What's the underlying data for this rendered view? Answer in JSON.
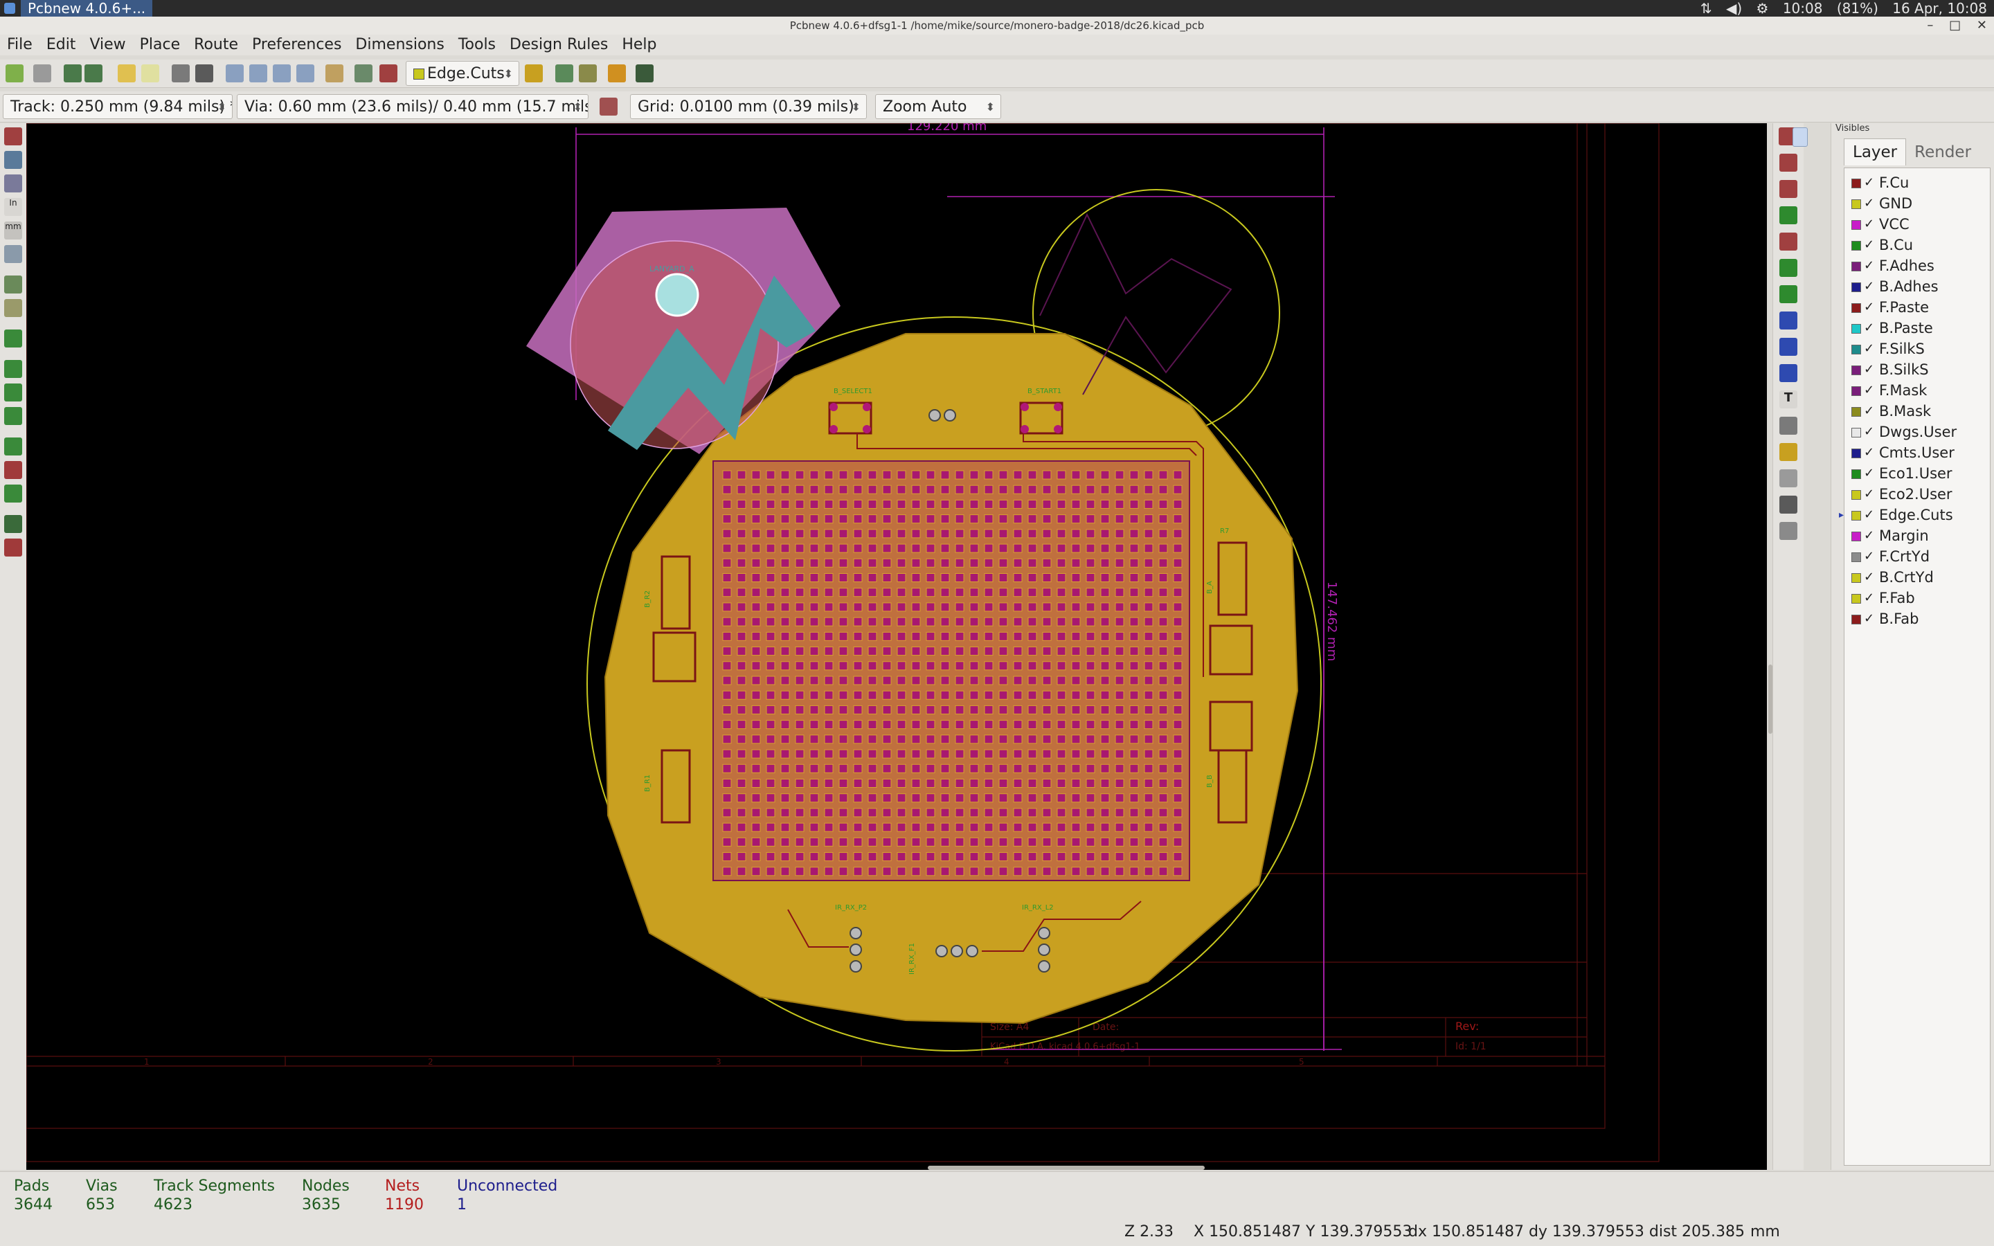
{
  "system_panel": {
    "task_title": "Pcbnew 4.0.6+...",
    "time": "10:08",
    "battery": "(81%)",
    "date_time": "16 Apr, 10:08"
  },
  "window": {
    "title": "Pcbnew 4.0.6+dfsg1-1 /home/mike/source/monero-badge-2018/dc26.kicad_pcb"
  },
  "menu": [
    "File",
    "Edit",
    "View",
    "Place",
    "Route",
    "Preferences",
    "Dimensions",
    "Tools",
    "Design Rules",
    "Help"
  ],
  "toolbar": {
    "layer_select": "Edge.Cuts",
    "track": "Track: 0.250 mm (9.84 mils) *",
    "via": "Via: 0.60 mm (23.6 mils)/ 0.40 mm (15.7 mils) *",
    "grid": "Grid: 0.0100 mm (0.39 mils)",
    "zoom": "Zoom Auto"
  },
  "board": {
    "dim_top": "129.220  mm",
    "dim_right": "147.462  mm",
    "labels": {
      "logo_ref": "LANYARD_A",
      "b_select": "B_SELECT1",
      "b_start": "B_START1",
      "ir_rx": "IR_RX_P2",
      "ir_rx2": "IR_RX_L2",
      "ir_rx3": "IR_RX_F1",
      "b_r2": "B_R2",
      "b_r1": "B_R1",
      "b_a": "B_A",
      "b_b": "B_B",
      "r7": "R7"
    },
    "title_block": {
      "size": "Size: A4",
      "date": "Date:",
      "kicad": "KiCad E.D.A.  kicad 4.0.6+dfsg1-1",
      "rev": "Rev:",
      "id": "Id: 1/1"
    },
    "frame_cols": [
      "1",
      "2",
      "3",
      "4",
      "5"
    ]
  },
  "layers": {
    "visibles_label": "Visibles",
    "tabs": [
      "Layer",
      "Render"
    ],
    "active_layer": "Edge.Cuts",
    "items": [
      {
        "name": "F.Cu",
        "color": "#8c1c1c"
      },
      {
        "name": "GND",
        "color": "#c8c81e"
      },
      {
        "name": "VCC",
        "color": "#c81ec8"
      },
      {
        "name": "B.Cu",
        "color": "#1e8c1e"
      },
      {
        "name": "F.Adhes",
        "color": "#7a1e7a"
      },
      {
        "name": "B.Adhes",
        "color": "#1e1e8c"
      },
      {
        "name": "F.Paste",
        "color": "#8c1c1c"
      },
      {
        "name": "B.Paste",
        "color": "#1ec8c8"
      },
      {
        "name": "F.SilkS",
        "color": "#1e8c8c"
      },
      {
        "name": "B.SilkS",
        "color": "#7a1e7a"
      },
      {
        "name": "F.Mask",
        "color": "#7a1e7a"
      },
      {
        "name": "B.Mask",
        "color": "#8c8c1e"
      },
      {
        "name": "Dwgs.User",
        "color": "#e8e8e8"
      },
      {
        "name": "Cmts.User",
        "color": "#1e1e8c"
      },
      {
        "name": "Eco1.User",
        "color": "#1e8c1e"
      },
      {
        "name": "Eco2.User",
        "color": "#c8c81e"
      },
      {
        "name": "Edge.Cuts",
        "color": "#c8c81e"
      },
      {
        "name": "Margin",
        "color": "#c81ec8"
      },
      {
        "name": "F.CrtYd",
        "color": "#8c8c8c"
      },
      {
        "name": "B.CrtYd",
        "color": "#c8c81e"
      },
      {
        "name": "F.Fab",
        "color": "#c8c81e"
      },
      {
        "name": "B.Fab",
        "color": "#8c1c1c"
      }
    ]
  },
  "stats": [
    {
      "label": "Pads",
      "value": "3644",
      "color": "#1e5a1e"
    },
    {
      "label": "Vias",
      "value": "653",
      "color": "#1e5a1e"
    },
    {
      "label": "Track Segments",
      "value": "4623",
      "color": "#1e5a1e"
    },
    {
      "label": "Nodes",
      "value": "3635",
      "color": "#1e5a1e"
    },
    {
      "label": "Nets",
      "value": "1190",
      "color": "#b41e1e"
    },
    {
      "label": "Unconnected",
      "value": "1",
      "color": "#1e1e8c"
    }
  ],
  "status": {
    "zoom": "Z 2.33",
    "xy": "X 150.851487  Y 139.379553",
    "dxy": "dx 150.851487  dy 139.379553  dist 205.385",
    "units": "mm"
  }
}
